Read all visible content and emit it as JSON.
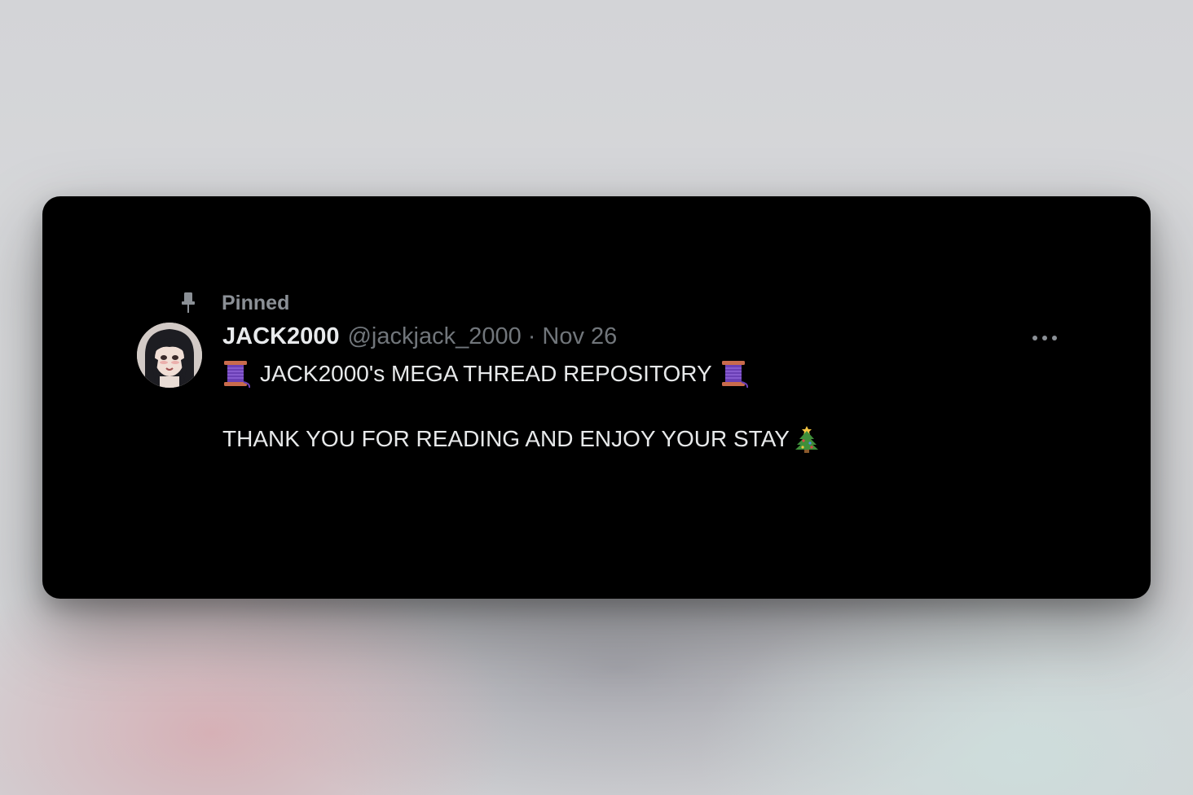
{
  "tweet": {
    "pinned_label": "Pinned",
    "display_name": "JACK2000",
    "handle": "@jackjack_2000",
    "separator": "·",
    "date": "Nov 26",
    "text_line1": "JACK2000's MEGA THREAD REPOSITORY",
    "text_line2": "THANK YOU FOR READING AND ENJOY YOUR STAY",
    "icons": {
      "pin": "pin-icon",
      "more": "more-icon",
      "thread_spool": "spool-of-thread-emoji",
      "christmas_tree": "christmas-tree-emoji"
    }
  },
  "colors": {
    "card_background": "#000000",
    "primary_text": "#e7e9ea",
    "secondary_text": "#71767b"
  }
}
